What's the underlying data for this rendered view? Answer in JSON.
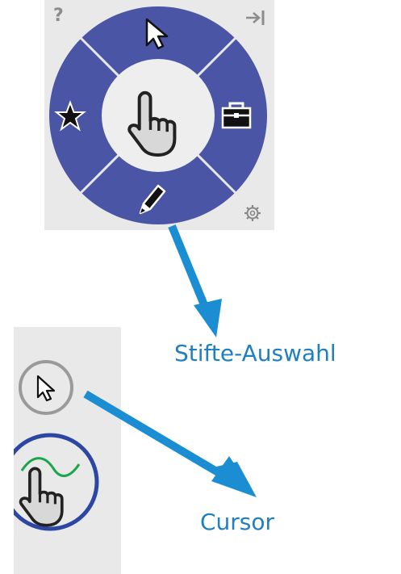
{
  "radial_menu": {
    "help_label": "?",
    "center_tool": "hand-pointer",
    "segments": [
      {
        "position": "top",
        "icon": "arrow-cursor-icon"
      },
      {
        "position": "right",
        "icon": "toolbox-icon"
      },
      {
        "position": "bottom",
        "icon": "pen-icon"
      },
      {
        "position": "left",
        "icon": "star-icon"
      }
    ],
    "corner_icons": {
      "top_left": "help-icon",
      "top_right": "collapse-to-edge-icon",
      "bottom_right": "gear-icon"
    },
    "ring_color": "#4a56a5",
    "center_color": "#eeeeee"
  },
  "side_toolbar": {
    "items": [
      {
        "icon": "arrow-cursor-icon",
        "state": "normal"
      },
      {
        "icon": "hand-pointer-icon",
        "state": "active"
      }
    ],
    "active_ring_color": "#2c47a3"
  },
  "annotations": {
    "pens_label": "Stifte-Auswahl",
    "cursor_label": "Cursor",
    "arrow_color": "#1b8ed3",
    "text_color": "#1f7fc1"
  }
}
